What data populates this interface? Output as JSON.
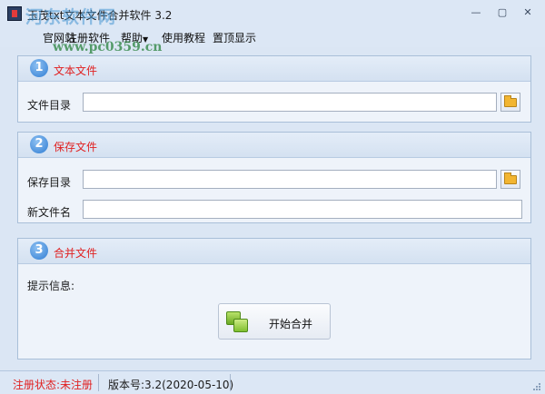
{
  "window": {
    "title": "玉茂txt文本文件合并软件 3.2",
    "minimize_glyph": "—",
    "maximize_glyph": "▢",
    "close_glyph": "✕"
  },
  "watermark": {
    "text": "河东软件网",
    "url": "www.pc0359.cn"
  },
  "menu": [
    {
      "label": "官网站",
      "has_dropdown": false
    },
    {
      "label": "注册软件",
      "has_dropdown": false
    },
    {
      "label": "帮助",
      "has_dropdown": true,
      "caret": "▼"
    },
    {
      "label": "使用教程",
      "has_dropdown": false
    },
    {
      "label": "置顶显示",
      "has_dropdown": false
    }
  ],
  "groups": {
    "text_files": {
      "number": "1",
      "title": "文本文件",
      "dir_label": "文件目录",
      "dir_value": ""
    },
    "save_files": {
      "number": "2",
      "title": "保存文件",
      "dir_label": "保存目录",
      "dir_value": "",
      "name_label": "新文件名",
      "name_value": ""
    },
    "merge": {
      "number": "3",
      "title": "合并文件",
      "info_label": "提示信息:",
      "button_label": "开始合并"
    }
  },
  "status": {
    "registration": "注册状态:未注册",
    "version": "版本号:3.2(2020-05-10)"
  },
  "colors": {
    "accent_red": "#e02020",
    "badge_blue": "#2f7dd3",
    "chrome_blue": "#dce7f5"
  },
  "icons": [
    "app-icon",
    "folder-icon",
    "merge-icon",
    "resize-grip-icon"
  ]
}
